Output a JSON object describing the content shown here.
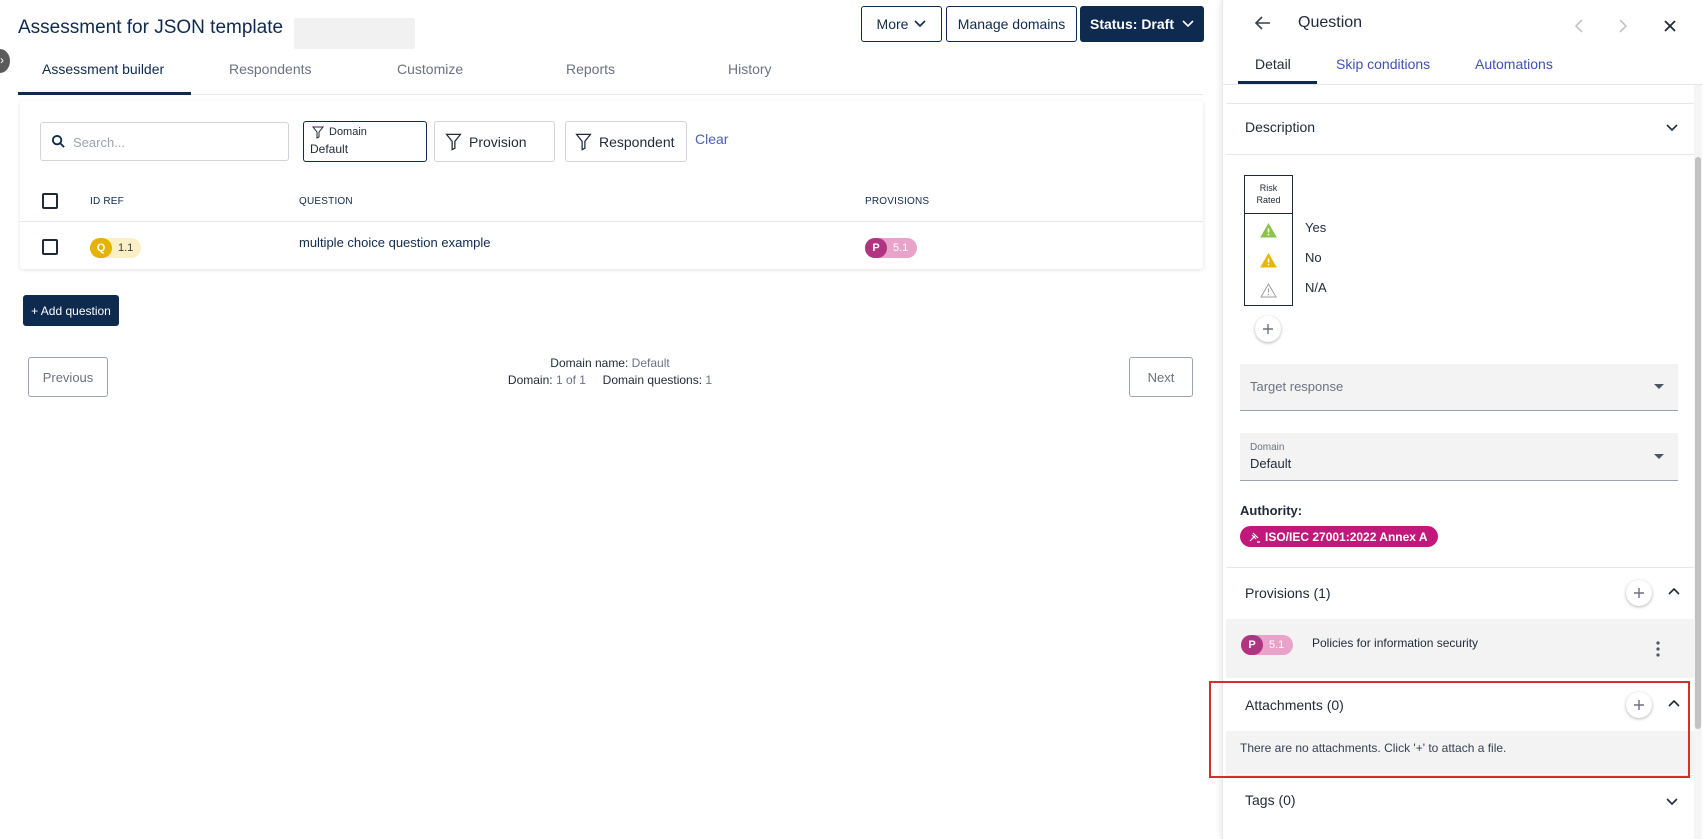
{
  "header": {
    "title": "Assessment for JSON template",
    "more_label": "More",
    "manage_domains_label": "Manage domains",
    "status_label": "Status: Draft"
  },
  "tabs": [
    "Assessment builder",
    "Respondents",
    "Customize",
    "Reports",
    "History"
  ],
  "filters": {
    "search_placeholder": "Search...",
    "domain_label": "Domain",
    "domain_value": "Default",
    "provision_label": "Provision",
    "respondent_label": "Respondent",
    "clear_label": "Clear"
  },
  "table": {
    "columns": [
      "ID REF",
      "QUESTION",
      "PROVISIONS"
    ],
    "rows": [
      {
        "id_prefix": "Q",
        "id_ref": "1.1",
        "question": "multiple choice question example",
        "provision_prefix": "P",
        "provision": "5.1"
      }
    ]
  },
  "add_question_label": "+ Add question",
  "pager": {
    "previous_label": "Previous",
    "next_label": "Next",
    "domain_name_label": "Domain name:",
    "domain_name_value": "Default",
    "domain_label": "Domain:",
    "domain_value": "1 of 1",
    "domain_questions_label": "Domain questions:",
    "domain_questions_value": "1"
  },
  "panel": {
    "title": "Question",
    "tabs": [
      "Detail",
      "Skip conditions",
      "Automations"
    ],
    "description_label": "Description",
    "risk_header_line1": "Risk",
    "risk_header_line2": "Rated",
    "answers": [
      {
        "label": "Yes",
        "icon": "warning-icon",
        "color": "#8bc34a"
      },
      {
        "label": "No",
        "icon": "warning-icon",
        "color": "#e6b800"
      },
      {
        "label": "N/A",
        "icon": "warning-outline-icon",
        "color": "#9e9e9e"
      }
    ],
    "target_response_placeholder": "Target response",
    "domain_field_label": "Domain",
    "domain_field_value": "Default",
    "authority_label": "Authority:",
    "authority_chip": "ISO/IEC 27001:2022 Annex A",
    "provisions_label": "Provisions (1)",
    "provision_item": {
      "prefix": "P",
      "number": "5.1",
      "text": "Policies for information security"
    },
    "attachments_label": "Attachments (0)",
    "attachments_empty": "There are no attachments. Click '+' to attach a file.",
    "tags_label": "Tags (0)"
  },
  "colors": {
    "navy": "#0f2a4f",
    "link_blue": "#4a5fb5",
    "q_badge": "#e6b200",
    "p_badge": "#b0347f",
    "authority_chip": "#c2187b",
    "highlight": "#d32f2f"
  }
}
